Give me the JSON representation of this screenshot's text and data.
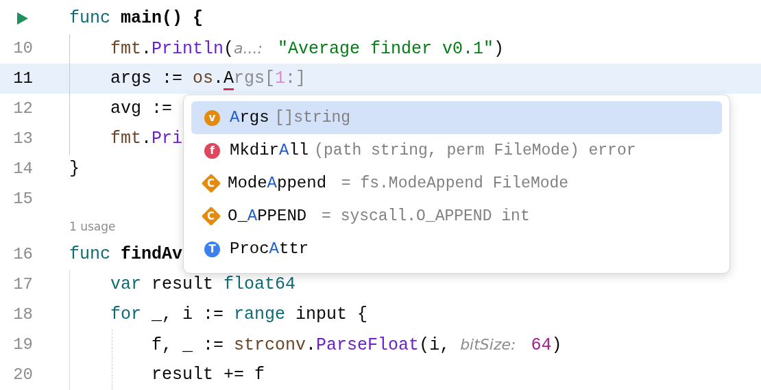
{
  "editor": {
    "lines": [
      {
        "kind": "run",
        "current": false,
        "tokens": [
          {
            "text": "func",
            "kind": "keyword"
          },
          {
            "text": " main() {",
            "kind": "bold"
          }
        ]
      },
      {
        "kind": "code",
        "number": "10",
        "current": false,
        "tokens": [
          {
            "text": "    fmt",
            "kind": "pkg"
          },
          {
            "text": ".",
            "kind": "plain"
          },
          {
            "text": "Println",
            "kind": "func"
          },
          {
            "text": "(",
            "kind": "plain"
          },
          {
            "text": "a...: ",
            "kind": "hint"
          },
          {
            "text": " \"Average finder v0.1\"",
            "kind": "string"
          },
          {
            "text": ")",
            "kind": "plain"
          }
        ]
      },
      {
        "kind": "code",
        "number": "11",
        "current": true,
        "tokens": [
          {
            "text": "    args := ",
            "kind": "plain"
          },
          {
            "text": "os",
            "kind": "pkg"
          },
          {
            "text": ".",
            "kind": "plain"
          },
          {
            "text": "A",
            "kind": "typed"
          },
          {
            "text": "rgs[",
            "kind": "preview"
          },
          {
            "text": "1",
            "kind": "preview-number"
          },
          {
            "text": ":]",
            "kind": "preview"
          }
        ]
      },
      {
        "kind": "code",
        "number": "12",
        "current": false,
        "tokens": [
          {
            "text": "    avg :=",
            "kind": "plain"
          }
        ]
      },
      {
        "kind": "code",
        "number": "13",
        "current": false,
        "tokens": [
          {
            "text": "    fmt",
            "kind": "pkg"
          },
          {
            "text": ".",
            "kind": "plain"
          },
          {
            "text": "Pri",
            "kind": "func"
          }
        ]
      },
      {
        "kind": "code",
        "number": "14",
        "current": false,
        "tokens": [
          {
            "text": "}",
            "kind": "plain"
          }
        ]
      },
      {
        "kind": "code",
        "number": "15",
        "current": false
      },
      {
        "kind": "usage",
        "text": "1 usage"
      },
      {
        "kind": "code",
        "number": "16",
        "current": false,
        "tokens": [
          {
            "text": "func",
            "kind": "keyword"
          },
          {
            "text": " findAv",
            "kind": "bold"
          }
        ]
      },
      {
        "kind": "code",
        "number": "17",
        "current": false,
        "tokens": [
          {
            "text": "    var",
            "kind": "keyword"
          },
          {
            "text": " result ",
            "kind": "plain"
          },
          {
            "text": "float64",
            "kind": "keyword"
          }
        ]
      },
      {
        "kind": "code",
        "number": "18",
        "current": false,
        "tokens": [
          {
            "text": "    for",
            "kind": "keyword"
          },
          {
            "text": " _, i := ",
            "kind": "plain"
          },
          {
            "text": "range",
            "kind": "keyword"
          },
          {
            "text": " input {",
            "kind": "plain"
          }
        ]
      },
      {
        "kind": "code",
        "number": "19",
        "current": false,
        "tokens": [
          {
            "text": "        f, _ := ",
            "kind": "plain"
          },
          {
            "text": "strconv",
            "kind": "pkg"
          },
          {
            "text": ".",
            "kind": "plain"
          },
          {
            "text": "ParseFloat",
            "kind": "func"
          },
          {
            "text": "(i, ",
            "kind": "plain"
          },
          {
            "text": "bitSize: ",
            "kind": "hint"
          },
          {
            "text": " 64",
            "kind": "number"
          },
          {
            "text": ")",
            "kind": "plain"
          }
        ]
      },
      {
        "kind": "code",
        "number": "20",
        "current": false,
        "tokens": [
          {
            "text": "        result += f",
            "kind": "plain"
          }
        ]
      }
    ]
  },
  "completion": {
    "items": [
      {
        "kind": "variable",
        "icon_letter": "v",
        "match": "A",
        "after": "rgs",
        "detail": "[]string",
        "selected": true
      },
      {
        "kind": "function",
        "icon_letter": "f",
        "before": "Mkdir",
        "match": "A",
        "after": "ll",
        "detail": "(path string, perm FileMode) error",
        "selected": false
      },
      {
        "kind": "constant",
        "icon_letter": "C",
        "before": "Mode",
        "match": "A",
        "after": "ppend",
        "detail": " = fs.ModeAppend FileMode",
        "selected": false
      },
      {
        "kind": "constant",
        "icon_letter": "C",
        "before": "O_",
        "match": "A",
        "after": "PPEND",
        "detail": " = syscall.O_APPEND int",
        "selected": false
      },
      {
        "kind": "type",
        "icon_letter": "T",
        "before": "Proc",
        "match": "A",
        "after": "ttr",
        "selected": false
      }
    ]
  }
}
